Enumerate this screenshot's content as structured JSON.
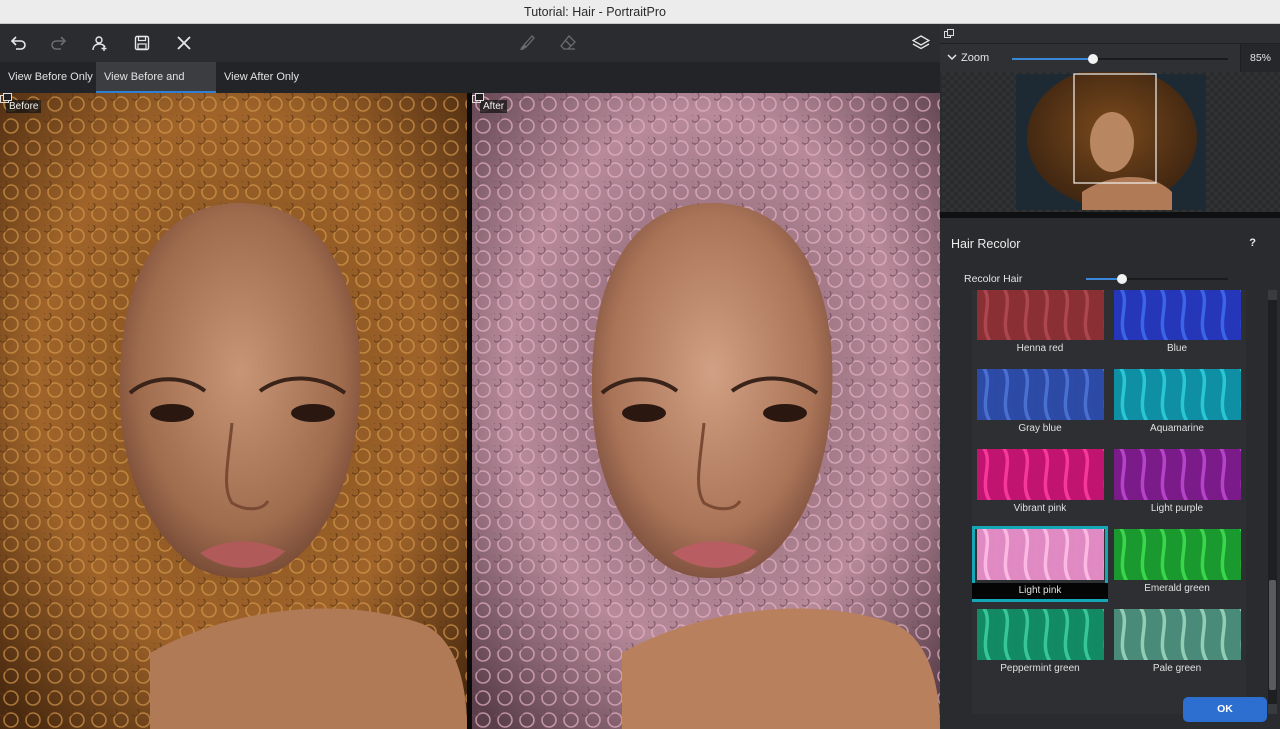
{
  "window": {
    "title": "Tutorial: Hair - PortraitPro"
  },
  "toolbar": {
    "icons": [
      "undo-icon",
      "redo-icon",
      "add-person-icon",
      "save-icon",
      "close-icon",
      "brush-icon",
      "eraser-icon",
      "layers-icon"
    ]
  },
  "view_tabs": [
    {
      "label": "View Before Only",
      "active": false
    },
    {
      "label": "View Before and After",
      "active": true
    },
    {
      "label": "View After Only",
      "active": false
    }
  ],
  "photos": {
    "before_label": "Before",
    "after_label": "After"
  },
  "zoom": {
    "label": "Zoom",
    "value": "85%",
    "level": 0.85
  },
  "panel": {
    "title": "Hair Recolor",
    "help": "?",
    "slider_label": "Recolor Hair",
    "slider_level": 0.25
  },
  "swatches": [
    {
      "name": "Henna red",
      "color": "#8a2f34",
      "hi": "#b24a55",
      "selected": false
    },
    {
      "name": "Blue",
      "color": "#2536b8",
      "hi": "#3f6cf0",
      "selected": false
    },
    {
      "name": "Gray blue",
      "color": "#2c4aa6",
      "hi": "#4f76d8",
      "selected": false
    },
    {
      "name": "Aquamarine",
      "color": "#0f8fa3",
      "hi": "#2ed0de",
      "selected": false
    },
    {
      "name": "Vibrant pink",
      "color": "#c01470",
      "hi": "#ff3fa0",
      "selected": false
    },
    {
      "name": "Light purple",
      "color": "#7b1b8a",
      "hi": "#c04ad2",
      "selected": false
    },
    {
      "name": "Light pink",
      "color": "#e08ac4",
      "hi": "#ffc0e8",
      "selected": true
    },
    {
      "name": "Emerald green",
      "color": "#1a9a2e",
      "hi": "#40e050",
      "selected": false
    },
    {
      "name": "Peppermint green",
      "color": "#128a64",
      "hi": "#3fd0a0",
      "selected": false
    },
    {
      "name": "Pale green",
      "color": "#4a8a78",
      "hi": "#9fd8c0",
      "selected": false
    }
  ],
  "ok_button": {
    "label": "OK"
  }
}
